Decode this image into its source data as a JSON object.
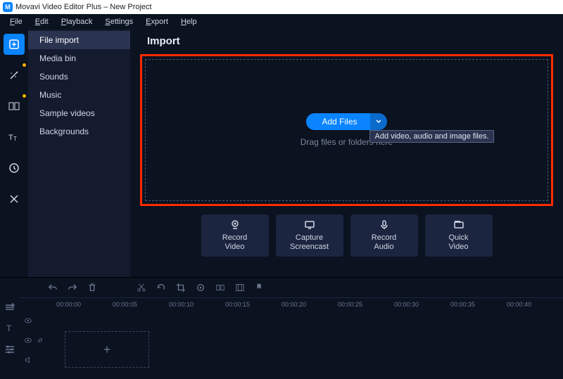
{
  "window": {
    "title": "Movavi Video Editor Plus – New Project"
  },
  "menu": [
    "File",
    "Edit",
    "Playback",
    "Settings",
    "Export",
    "Help"
  ],
  "tools": [
    {
      "name": "import-icon",
      "active": true,
      "dot": false
    },
    {
      "name": "filters-icon",
      "active": false,
      "dot": true
    },
    {
      "name": "transitions-icon",
      "active": false,
      "dot": true
    },
    {
      "name": "titles-icon",
      "active": false,
      "dot": false
    },
    {
      "name": "stickers-icon",
      "active": false,
      "dot": false
    },
    {
      "name": "more-tools-icon",
      "active": false,
      "dot": false
    }
  ],
  "sidebar": {
    "items": [
      {
        "label": "File import",
        "selected": true
      },
      {
        "label": "Media bin",
        "selected": false
      },
      {
        "label": "Sounds",
        "selected": false
      },
      {
        "label": "Music",
        "selected": false
      },
      {
        "label": "Sample videos",
        "selected": false
      },
      {
        "label": "Backgrounds",
        "selected": false
      }
    ]
  },
  "main": {
    "title": "Import",
    "add_files": "Add Files",
    "drag_hint": "Drag files or folders here",
    "tooltip": "Add video, audio and image files."
  },
  "tiles": [
    {
      "icon": "webcam-icon",
      "line1": "Record",
      "line2": "Video"
    },
    {
      "icon": "screencast-icon",
      "line1": "Capture",
      "line2": "Screencast"
    },
    {
      "icon": "mic-icon",
      "line1": "Record",
      "line2": "Audio"
    },
    {
      "icon": "quickvideo-icon",
      "line1": "Quick",
      "line2": "Video"
    }
  ],
  "timeline": {
    "timecodes": [
      "00:00:00",
      "00:00:05",
      "00:00:10",
      "00:00:15",
      "00:00:20",
      "00:00:25",
      "00:00:30",
      "00:00:35",
      "00:00:40"
    ],
    "add_label": "+"
  }
}
